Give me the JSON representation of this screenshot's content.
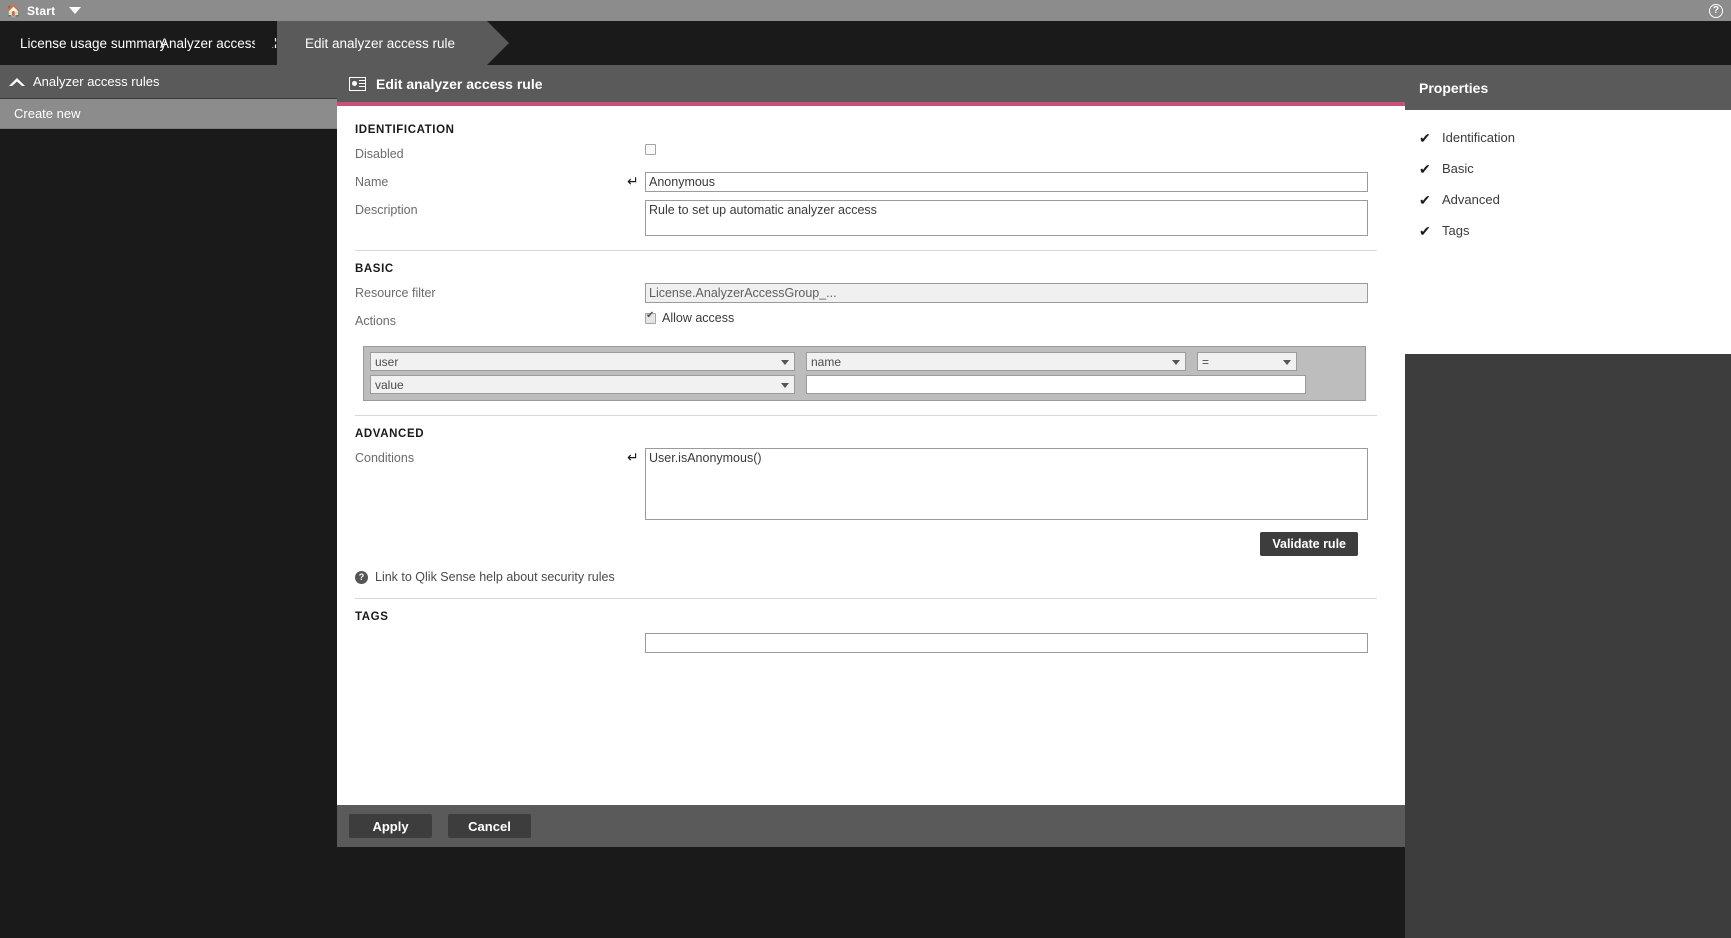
{
  "topbar": {
    "home_icon": "home-icon",
    "start_label": "Start",
    "dropdown_icon": "chevron-down-icon",
    "help_icon": "help-icon",
    "help_glyph": "?"
  },
  "breadcrumbs": [
    {
      "label": "License usage summary",
      "active": false
    },
    {
      "label": "Analyzer access rules",
      "active": false
    },
    {
      "label": "Edit analyzer access rule",
      "active": true
    }
  ],
  "sidebar": {
    "header": {
      "label": "Analyzer access rules",
      "collapse_icon": "chevron-up-icon"
    },
    "items": [
      {
        "label": "Create new"
      }
    ]
  },
  "main": {
    "header": {
      "title": "Edit analyzer access rule",
      "icon": "id-card-icon"
    },
    "sections": {
      "identification": {
        "title": "IDENTIFICATION",
        "disabled_label": "Disabled",
        "disabled_checked": false,
        "name_label": "Name",
        "name_value": "Anonymous",
        "name_undo_icon": "undo-icon",
        "description_label": "Description",
        "description_value": "Rule to set up automatic analyzer access"
      },
      "basic": {
        "title": "BASIC",
        "resource_filter_label": "Resource filter",
        "resource_filter_value": "License.AnalyzerAccessGroup_...",
        "actions_label": "Actions",
        "allow_access_label": "Allow access",
        "allow_access_checked": true,
        "rule": {
          "resource_select": "user",
          "property_select": "name",
          "operator_select": "=",
          "value_select": "value",
          "value_input": "",
          "value_input_placeholder": ""
        }
      },
      "advanced": {
        "title": "ADVANCED",
        "conditions_label": "Conditions",
        "conditions_value": "User.isAnonymous()",
        "conditions_undo_icon": "undo-icon",
        "validate_button": "Validate rule",
        "help_link_text": "Link to Qlik Sense help about security rules",
        "help_link_icon": "question-circle-icon"
      },
      "tags": {
        "title": "TAGS",
        "value": "",
        "placeholder": ""
      }
    }
  },
  "footer": {
    "apply_label": "Apply",
    "cancel_label": "Cancel"
  },
  "properties": {
    "title": "Properties",
    "items": [
      {
        "label": "Identification",
        "check_icon": "check-icon"
      },
      {
        "label": "Basic",
        "check_icon": "check-icon"
      },
      {
        "label": "Advanced",
        "check_icon": "check-icon"
      },
      {
        "label": "Tags",
        "check_icon": "check-icon"
      }
    ]
  },
  "colors": {
    "accent_pink": "#c8517c",
    "topbar_gray": "#8c8c8c",
    "panel_dark": "#5a5a5a",
    "black": "#1a1a1a"
  }
}
